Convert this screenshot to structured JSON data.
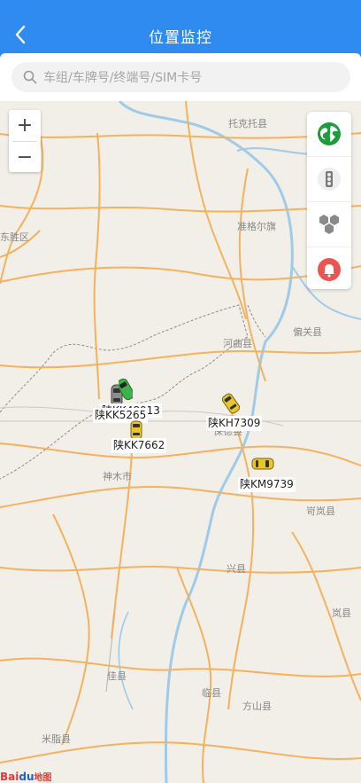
{
  "header": {
    "title": "位置监控"
  },
  "search": {
    "placeholder": "车组/车牌号/终端号/SIM卡号"
  },
  "zoom": {
    "in_label": "+",
    "out_label": "−"
  },
  "vehicles": [
    {
      "plate": "陕KK5265",
      "status": "gray"
    },
    {
      "plate": "陕KK7662",
      "status": "yellow"
    },
    {
      "plate": "陕KH7309",
      "status": "yellow"
    },
    {
      "plate": "陕KM9739",
      "status": "yellow"
    },
    {
      "plate": "陕KK48013",
      "status": "green"
    }
  ],
  "places": {
    "tuoketuo": "托克托县",
    "dongsheng": "东胜区",
    "zhungeer": "准格尔旗",
    "pianguan": "偏关县",
    "hequ": "河曲县",
    "baode": "保德县",
    "shenmu": "神木市",
    "kelan": "岢岚县",
    "xing": "兴县",
    "lan": "岚县",
    "jia": "佳县",
    "lin": "临县",
    "fangshan": "方山县",
    "mizhi": "米脂县"
  },
  "logo": {
    "bai": "Bai",
    "du": "du",
    "map": "地图"
  },
  "colors": {
    "header": "#2f8bf0",
    "river": "#9fcbe8",
    "road": "#f4b25e",
    "border": "#9e9e9e"
  }
}
